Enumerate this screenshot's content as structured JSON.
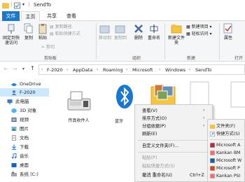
{
  "window": {
    "title": "SendTo"
  },
  "ribbon_tabs": {
    "file": "文件",
    "home": "主页",
    "share": "共享",
    "view": "查看"
  },
  "ribbon": {
    "pin_quick_access": "固定到快速访问",
    "copy": "复制",
    "paste": "粘贴",
    "copy_path": "复制路径",
    "paste_shortcut": "粘贴快捷方式",
    "cut": "剪切",
    "clipboard_group": "剪贴板",
    "move_to": "移动到",
    "copy_to": "复制到",
    "delete": "删除",
    "rename": "重命名",
    "organize_group": "组织",
    "new_item": "新建项目",
    "easy_access": "轻松访问",
    "new_folder": "新建文件夹",
    "new_group": "新建",
    "properties": "属性",
    "open_group": "打开"
  },
  "address_bar": {
    "crumbs": [
      "F-2020",
      "AppData",
      "Roaming",
      "Microsoft",
      "Windows",
      "SendTo"
    ]
  },
  "nav_pane": {
    "items": [
      {
        "label": "OneDrive"
      },
      {
        "label": "F-2020"
      },
      {
        "label": "此电脑"
      },
      {
        "label": "3D 对象"
      },
      {
        "label": "视频"
      },
      {
        "label": "图片"
      },
      {
        "label": "文档"
      },
      {
        "label": "下载"
      },
      {
        "label": "音乐"
      },
      {
        "label": "桌面"
      },
      {
        "label": "系统 (C:)"
      }
    ]
  },
  "files": [
    {
      "label": "传真收件人"
    },
    {
      "label": "蓝牙"
    }
  ],
  "context_menu": {
    "items": [
      {
        "label": "查看(V)",
        "has_submenu": true
      },
      {
        "label": "排序方式(O)",
        "has_submenu": true
      },
      {
        "label": "分组依据(P)",
        "has_submenu": true
      },
      {
        "label": "刷新(E)"
      },
      {
        "label": "自定义文件夹(F)..."
      },
      {
        "label": "粘贴(P)",
        "disabled": true
      },
      {
        "label": "粘贴快捷方式(S)",
        "disabled": true
      },
      {
        "label": "撤消 重命名(U)",
        "shortcut": "Ctrl+Z"
      }
    ]
  },
  "new_submenu": {
    "items": [
      {
        "label": "文件夹(F)"
      },
      {
        "label": "快捷方式(S)"
      },
      {
        "label": "Microsoft A"
      },
      {
        "label": "Kankan BM"
      },
      {
        "label": "Microsoft W"
      },
      {
        "label": "Microsoft P"
      },
      {
        "label": "Kankan PSI"
      }
    ]
  },
  "colors": {
    "accent": "#1979ca",
    "selection": "#cce8ff",
    "bluetooth": "#1976d2",
    "folder": "#f5c542"
  }
}
